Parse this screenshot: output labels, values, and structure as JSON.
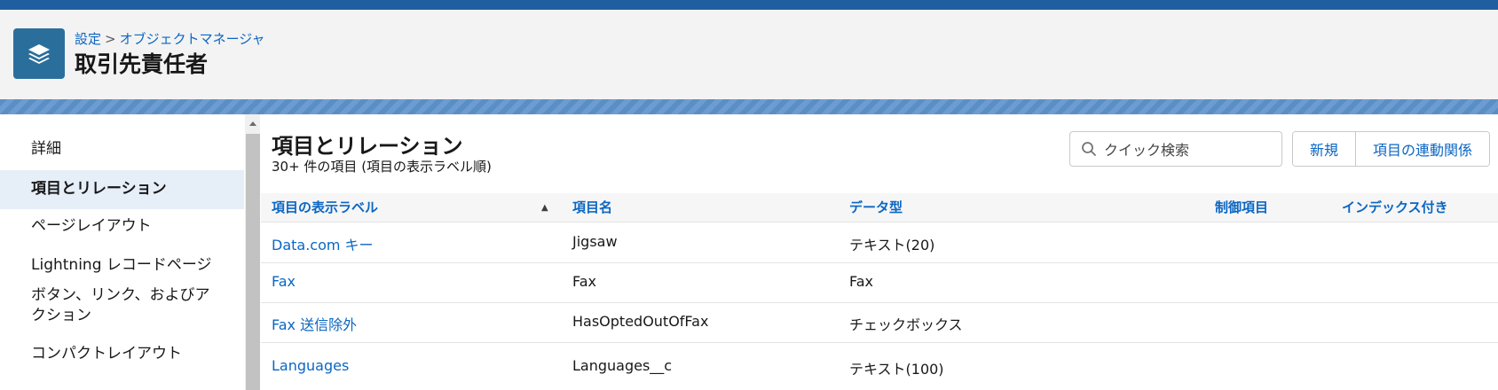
{
  "header": {
    "breadcrumb_root": "設定",
    "breadcrumb_sep": ">",
    "breadcrumb_current": "オブジェクトマネージャ",
    "title": "取引先責任者",
    "icon": "stack-layers-icon"
  },
  "sidebar": {
    "items": [
      {
        "label": "詳細"
      },
      {
        "label": "項目とリレーション"
      },
      {
        "label": "ページレイアウト"
      },
      {
        "label": "Lightning レコードページ"
      },
      {
        "label": "ボタン、リンク、およびア"
      },
      {
        "label": "クション"
      },
      {
        "label": "コンパクトレイアウト"
      }
    ]
  },
  "main": {
    "title": "項目とリレーション",
    "subtitle": "30+ 件の項目 (項目の表示ラベル順)",
    "search_placeholder": "クイック検索",
    "buttons": {
      "new": "新規",
      "dependencies": "項目の連動関係"
    },
    "columns": [
      "項目の表示ラベル",
      "項目名",
      "データ型",
      "制御項目",
      "インデックス付き"
    ],
    "sort_indicator": "▲",
    "rows": [
      {
        "label": "Data.com キー",
        "api": "Jigsaw",
        "type": "テキスト(20)"
      },
      {
        "label": "Fax",
        "api": "Fax",
        "type": "Fax"
      },
      {
        "label": "Fax 送信除外",
        "api": "HasOptedOutOfFax",
        "type": "チェックボックス"
      },
      {
        "label": "Languages",
        "api": "Languages__c",
        "type": "テキスト(100)"
      }
    ]
  },
  "colors": {
    "accent": "#0b66c3",
    "header_bg": "#f3f3f3",
    "icon_bg": "#2a6f9c",
    "active_item_bg": "#e6eef8"
  }
}
